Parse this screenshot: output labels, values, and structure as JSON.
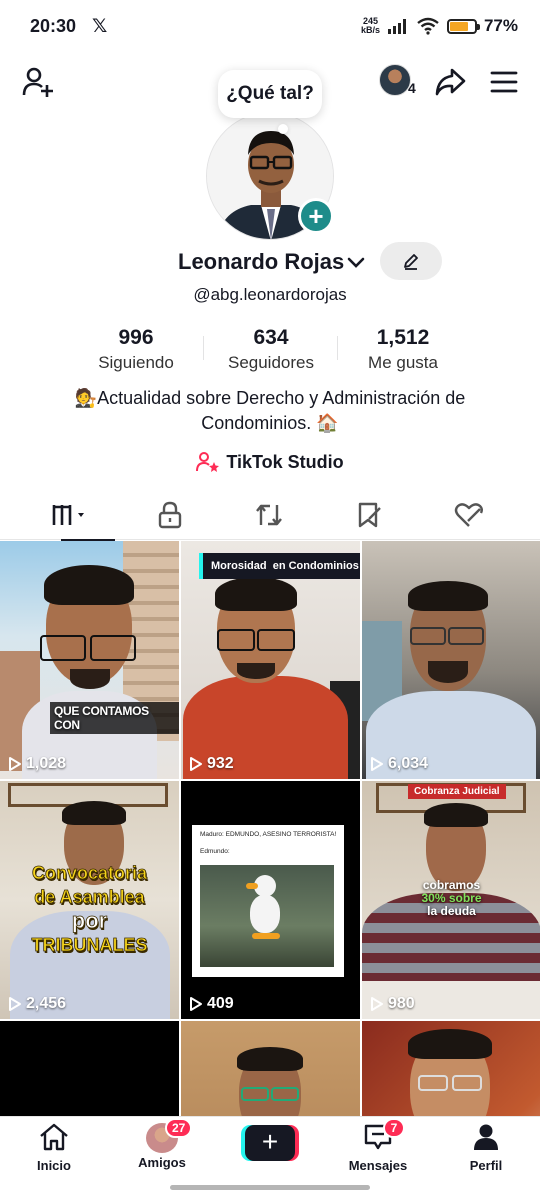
{
  "status_bar": {
    "time": "20:30",
    "app_icon": "x-logo",
    "net_speed_value": "245",
    "net_speed_unit": "kB/s",
    "battery_level": 0.77,
    "battery_label": "77%",
    "battery_color": "#f5a623"
  },
  "top_bar": {
    "add_friend_icon": "add-friend-icon",
    "account_count": "4",
    "share_icon": "share-icon",
    "menu_icon": "hamburger-menu-icon"
  },
  "profile": {
    "bubble_text": "¿Qué tal?",
    "name": "Leonardo Rojas",
    "handle": "@abg.leonardorojas",
    "add_story_symbol": "+",
    "stats": [
      {
        "value": "996",
        "label": "Siguiendo"
      },
      {
        "value": "634",
        "label": "Seguidores"
      },
      {
        "value": "1,512",
        "label": "Me gusta"
      }
    ],
    "bio_line1": "🧑‍⚖️Actualidad sobre Derecho y Administración de",
    "bio_line2": "Condominios. 🏠",
    "studio_label": "TikTok Studio",
    "accent_color": "#fe2c55"
  },
  "tabs": [
    {
      "name": "videos-grid-icon",
      "active": true
    },
    {
      "name": "lock-icon",
      "active": false
    },
    {
      "name": "repost-icon",
      "active": false
    },
    {
      "name": "bookmark-icon",
      "active": false
    },
    {
      "name": "liked-icon",
      "active": false
    }
  ],
  "videos": [
    {
      "views": "1,028",
      "caption": "QUE CONTAMOS CON"
    },
    {
      "views": "932",
      "caption": "Morosidad  en Condominios"
    },
    {
      "views": "6,034",
      "caption": ""
    },
    {
      "views": "2,456",
      "caption_line1": "Convocatoria",
      "caption_line2": "de Asamblea",
      "caption_line3": "por",
      "caption_line4": "TRIBUNALES"
    },
    {
      "views": "409",
      "caption_line1": "Maduro: EDMUNDO, ASESINO TERRORISTA!",
      "caption_line2": "Edmundo:"
    },
    {
      "views": "980",
      "caption_top": "Cobranza Judicial",
      "caption_line1": "cobramos",
      "caption_line2": "30% sobre",
      "caption_line3": "la deuda"
    }
  ],
  "bottom_nav": {
    "home_label": "Inicio",
    "friends_label": "Amigos",
    "friends_badge": "27",
    "create_symbol": "+",
    "messages_label": "Mensajes",
    "messages_badge": "7",
    "profile_label": "Perfil"
  }
}
